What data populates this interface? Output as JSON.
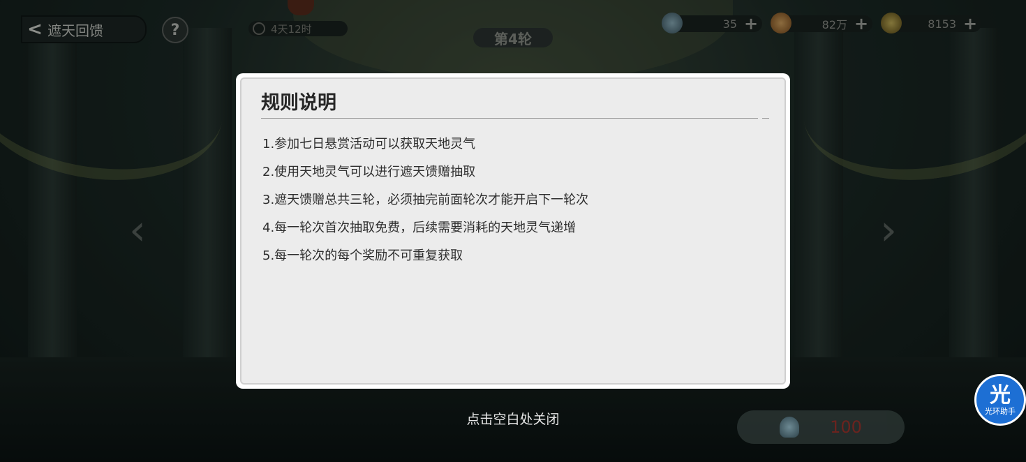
{
  "header": {
    "back_label": "遮天回馈",
    "help_glyph": "?",
    "timer": "4天12时",
    "round": "第4轮"
  },
  "currencies": [
    {
      "icon": "bell-icon",
      "value": "35",
      "plus": "+"
    },
    {
      "icon": "coin-icon",
      "value": "82万",
      "plus": "+"
    },
    {
      "icon": "gourd-icon",
      "value": "8153",
      "plus": "+"
    }
  ],
  "modal": {
    "title": "规则说明",
    "rules": [
      "1.参加七日悬赏活动可以获取天地灵气",
      "2.使用天地灵气可以进行遮天馈赠抽取",
      "3.遮天馈赠总共三轮，必须抽完前面轮次才能开启下一轮次",
      "4.每一轮次首次抽取免费，后续需要消耗的天地灵气递增",
      "5.每一轮次的每个奖励不可重复获取"
    ]
  },
  "close_hint": "点击空白处关闭",
  "cost_button": {
    "value": "100"
  },
  "assistant": {
    "glyph": "光",
    "label": "光环助手"
  },
  "nav": {
    "left_arrow": "‹",
    "right_arrow": "›"
  },
  "colors": {
    "accent_cost": "#8c2a24",
    "assistant_blue": "#1d6fd4"
  }
}
